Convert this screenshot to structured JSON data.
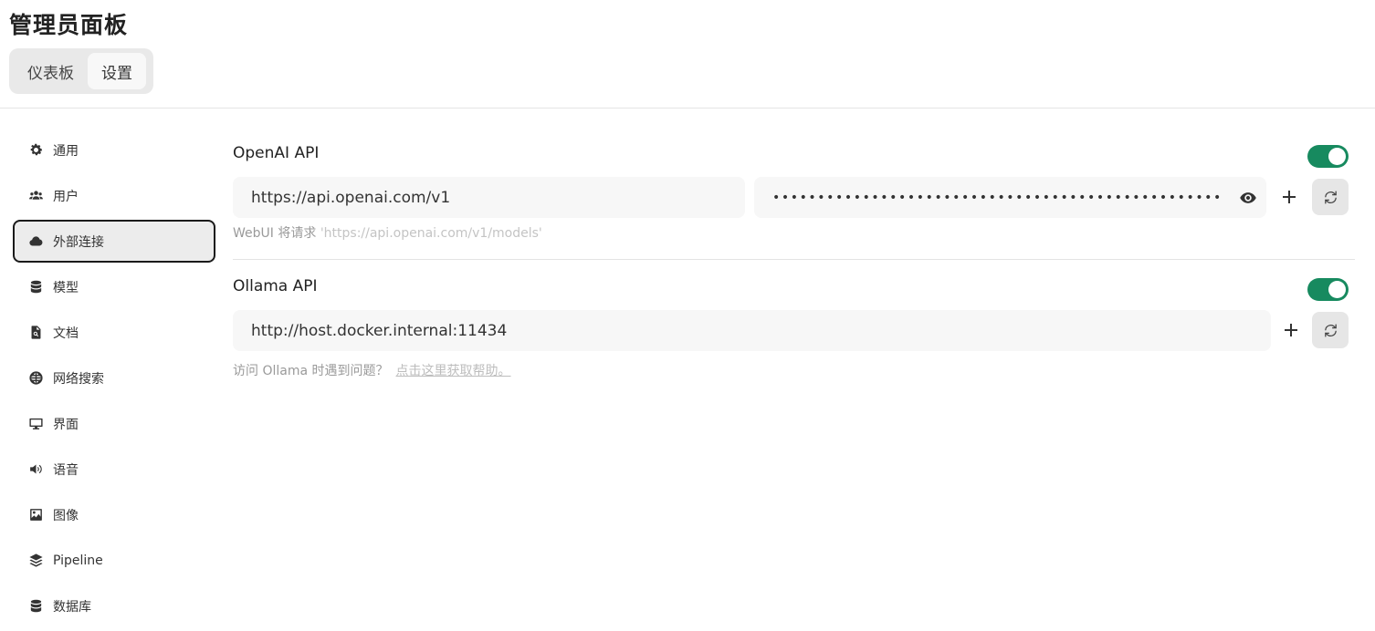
{
  "page_title": "管理员面板",
  "tabs": [
    {
      "label": "仪表板",
      "active": false
    },
    {
      "label": "设置",
      "active": true
    }
  ],
  "sidebar": {
    "items": [
      {
        "label": "通用",
        "icon": "gear-icon"
      },
      {
        "label": "用户",
        "icon": "users-icon"
      },
      {
        "label": "外部连接",
        "icon": "cloud-icon",
        "active": true
      },
      {
        "label": "模型",
        "icon": "database-icon"
      },
      {
        "label": "文档",
        "icon": "document-search-icon"
      },
      {
        "label": "网络搜索",
        "icon": "globe-icon"
      },
      {
        "label": "界面",
        "icon": "monitor-icon"
      },
      {
        "label": "语音",
        "icon": "speaker-icon"
      },
      {
        "label": "图像",
        "icon": "image-icon"
      },
      {
        "label": "Pipeline",
        "icon": "layers-icon"
      },
      {
        "label": "数据库",
        "icon": "database-icon"
      }
    ]
  },
  "openai": {
    "title": "OpenAI API",
    "enabled": true,
    "url_value": "https://api.openai.com/v1",
    "key_masked": "••••••••••••••••••••••••••••••••••••••••••••••••••",
    "hint_prefix": "WebUI 将请求 ",
    "hint_url": "'https://api.openai.com/v1/models'"
  },
  "ollama": {
    "title": "Ollama API",
    "enabled": true,
    "url_value": "http://host.docker.internal:11434",
    "hint_text": "访问 Ollama 时遇到问题？",
    "hint_link": "点击这里获取帮助。"
  },
  "colors": {
    "toggle_on": "#178a5f",
    "field_bg": "#f7f7f7"
  }
}
